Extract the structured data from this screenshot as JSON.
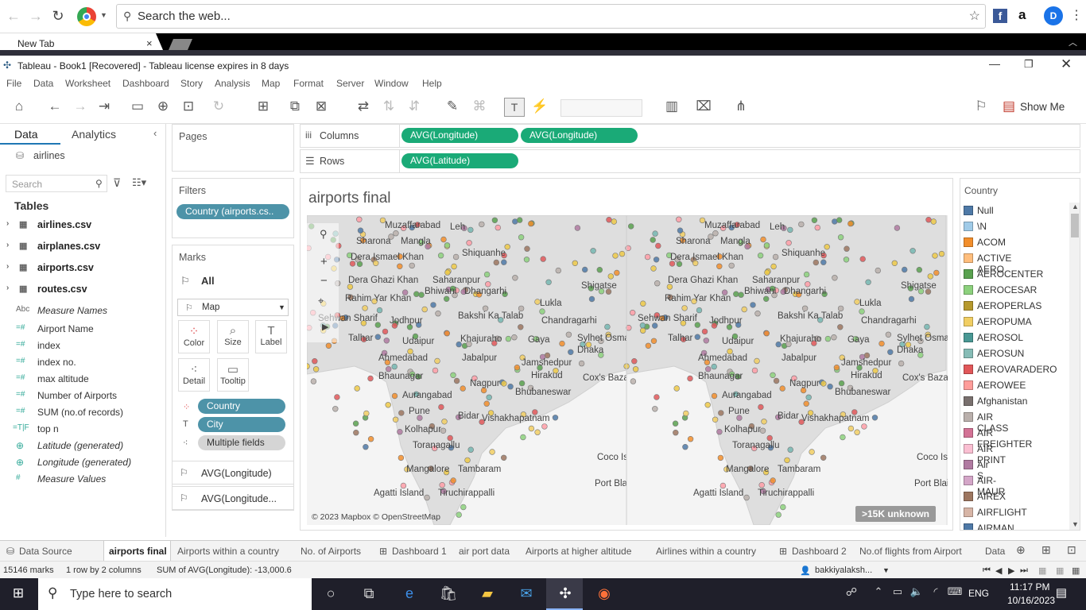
{
  "browser": {
    "search_placeholder": "Search the web...",
    "tab_title": "New Tab"
  },
  "window": {
    "title": "Tableau - Book1 [Recovered] - Tableau license expires in 8 days"
  },
  "menu": [
    "File",
    "Data",
    "Worksheet",
    "Dashboard",
    "Story",
    "Analysis",
    "Map",
    "Format",
    "Server",
    "Window",
    "Help"
  ],
  "toolbar": {
    "show_me": "Show Me"
  },
  "data_pane": {
    "tab_data": "Data",
    "tab_analytics": "Analytics",
    "datasource": "airlines",
    "search_placeholder": "Search",
    "tables_heading": "Tables",
    "tables": [
      "airlines.csv",
      "airplanes.csv",
      "airports.csv",
      "routes.csv"
    ],
    "fields": [
      {
        "icon": "Abc",
        "name": "Measure Names",
        "italic": true
      },
      {
        "icon": "=#",
        "name": "Airport Name",
        "italic": false
      },
      {
        "icon": "=#",
        "name": "index",
        "italic": false
      },
      {
        "icon": "=#",
        "name": "index no.",
        "italic": false
      },
      {
        "icon": "=#",
        "name": "max altitude",
        "italic": false
      },
      {
        "icon": "=#",
        "name": "Number of Airports",
        "italic": false
      },
      {
        "icon": "=#",
        "name": "SUM (no.of records)",
        "italic": false
      },
      {
        "icon": "=T|F",
        "name": "top n",
        "italic": false
      },
      {
        "icon": "globe",
        "name": "Latitude (generated)",
        "italic": true
      },
      {
        "icon": "globe",
        "name": "Longitude (generated)",
        "italic": true
      },
      {
        "icon": "#",
        "name": "Measure Values",
        "italic": true
      }
    ]
  },
  "pages": {
    "title": "Pages"
  },
  "filters": {
    "title": "Filters",
    "items": [
      "Country (airports.cs.."
    ]
  },
  "marks": {
    "title": "Marks",
    "all_label": "All",
    "type": "Map",
    "buttons": [
      "Color",
      "Size",
      "Label",
      "Detail",
      "Tooltip"
    ],
    "encodings": [
      "Country",
      "City",
      "Multiple fields"
    ],
    "sub_cards": [
      "AVG(Longitude)",
      "AVG(Longitude..."
    ]
  },
  "shelves": {
    "columns_label": "Columns",
    "rows_label": "Rows",
    "columns": [
      "AVG(Longitude)",
      "AVG(Longitude)"
    ],
    "rows": [
      "AVG(Latitude)"
    ]
  },
  "view": {
    "title": "airports final",
    "attribution": "© 2023 Mapbox © OpenStreetMap",
    "unknown_badge": ">15K unknown",
    "places": [
      "Muzaffarabad",
      "Leh",
      "Sharona",
      "Mangla",
      "Dera Ismael Khan",
      "Shiquanhe",
      "Dera Ghazi Khan",
      "Saharanpur",
      "Shigatse",
      "Bhiwani",
      "Dhangarhi",
      "Rahim Yar Khan",
      "Lukla",
      "Sehwan Sharif",
      "Jodhpur",
      "Bakshi Ka Talab",
      "Chandragarhi",
      "Talhar",
      "Udaipur",
      "Khajuraho",
      "Gaya",
      "Sylhet Osmani",
      "Dhaka",
      "Ahmedabad",
      "Jabalpur",
      "Jamshedpur",
      "Bhaunagar",
      "Hirakud",
      "Cox's Bazar",
      "Nagpur",
      "Bhubaneswar",
      "Aurangabad",
      "Pune",
      "Bidar",
      "Vishakhapatnam",
      "Kolhapur",
      "Toranagallu",
      "Coco Is",
      "Mangalore",
      "Tambaram",
      "Port Blair",
      "Agatti Island",
      "Tiruchirappalli"
    ]
  },
  "legend": {
    "title": "Country",
    "items": [
      {
        "label": "Null",
        "color": "#4e79a7"
      },
      {
        "label": "\\N",
        "color": "#a0cbe8"
      },
      {
        "label": "ACOM",
        "color": "#f28e2b"
      },
      {
        "label": "ACTIVE AERO",
        "color": "#ffbe7d"
      },
      {
        "label": "AEROCENTER",
        "color": "#59a14f"
      },
      {
        "label": "AEROCESAR",
        "color": "#8cd17d"
      },
      {
        "label": "AEROPERLAS",
        "color": "#b6992d"
      },
      {
        "label": "AEROPUMA",
        "color": "#f1ce63"
      },
      {
        "label": "AEROSOL",
        "color": "#499894"
      },
      {
        "label": "AEROSUN",
        "color": "#86bcb6"
      },
      {
        "label": "AEROVARADERO",
        "color": "#e15759"
      },
      {
        "label": "AEROWEE",
        "color": "#ff9d9a"
      },
      {
        "label": "Afghanistan",
        "color": "#79706e"
      },
      {
        "label": "AIR CLASS",
        "color": "#bab0ac"
      },
      {
        "label": "AIR FREIGHTER",
        "color": "#d37295"
      },
      {
        "label": "AIR PRINT",
        "color": "#fabfd2"
      },
      {
        "label": "Air S",
        "color": "#b07aa1"
      },
      {
        "label": "AIR-MAUR",
        "color": "#d4a6c8"
      },
      {
        "label": "AIREX",
        "color": "#9d7660"
      },
      {
        "label": "AIRFLIGHT",
        "color": "#d7b5a6"
      },
      {
        "label": "AIRMAN",
        "color": "#4e79a7"
      }
    ]
  },
  "sheet_tabs": [
    "Data Source",
    "airports final",
    "Airports within a country",
    "No. of Airports",
    "Dashboard 1",
    "air port data",
    "Airports at higher altitude",
    "Airlines within a country",
    "Dashboard 2",
    "No.of flights from Airport",
    "Data"
  ],
  "status": {
    "marks": "15146 marks",
    "rows": "1 row by 2 columns",
    "sum": "SUM of AVG(Longitude): -13,000.6",
    "user": "bakkiyalaksh..."
  },
  "taskbar": {
    "search_placeholder": "Type here to search",
    "lang": "ENG",
    "time": "11:17 PM",
    "date": "10/16/2023"
  }
}
